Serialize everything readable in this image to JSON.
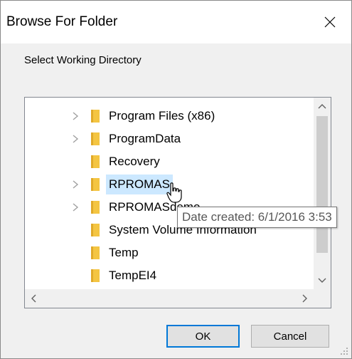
{
  "window": {
    "title": "Browse For Folder",
    "instruction": "Select Working Directory"
  },
  "tree": {
    "items": [
      {
        "label": "Program Files (x86)",
        "expandable": true,
        "selected": false
      },
      {
        "label": "ProgramData",
        "expandable": true,
        "selected": false
      },
      {
        "label": "Recovery",
        "expandable": false,
        "selected": false
      },
      {
        "label": "RPROMAS",
        "expandable": true,
        "selected": true
      },
      {
        "label": "RPROMASdemo",
        "expandable": true,
        "selected": false
      },
      {
        "label": "System Volume Information",
        "expandable": false,
        "selected": false
      },
      {
        "label": "Temp",
        "expandable": false,
        "selected": false
      },
      {
        "label": "TempEI4",
        "expandable": false,
        "selected": false
      }
    ]
  },
  "tooltip": {
    "text": "Date created: 6/1/2016 3:53"
  },
  "buttons": {
    "ok": "OK",
    "cancel": "Cancel"
  },
  "colors": {
    "folder": "#f4c542",
    "selection": "#cce8ff",
    "default_button_border": "#0078d7"
  },
  "icons": {
    "close": "close-icon",
    "expand": "chevron-right-icon",
    "folder": "folder-icon",
    "scroll_up": "arrow-up-icon",
    "scroll_down": "arrow-down-icon",
    "scroll_left": "arrow-left-icon",
    "scroll_right": "arrow-right-icon",
    "cursor": "hand-cursor-icon",
    "grip": "resize-grip-icon"
  }
}
